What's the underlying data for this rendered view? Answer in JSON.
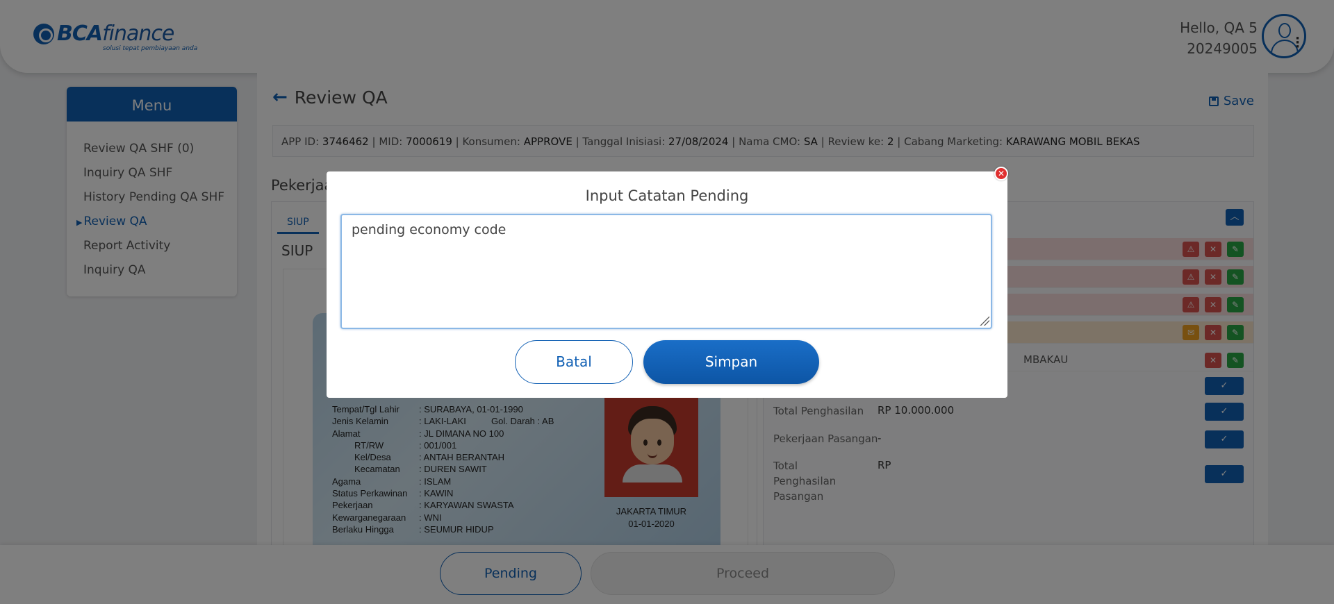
{
  "header": {
    "logo_text_bold": "BCA",
    "logo_text_rest": "finance",
    "logo_tagline": "solusi tepat pembiayaan anda",
    "greeting": "Hello, QA 5",
    "user_id": "20249005"
  },
  "sidebar": {
    "title": "Menu",
    "items": [
      {
        "label": "Review QA SHF (0)"
      },
      {
        "label": "Inquiry QA SHF"
      },
      {
        "label": "History Pending QA SHF"
      },
      {
        "label": "Review QA",
        "active": true
      },
      {
        "label": "Report Activity"
      },
      {
        "label": "Inquiry QA"
      }
    ]
  },
  "main": {
    "title": "Review QA",
    "save_label": "Save",
    "info": {
      "app_id_label": "APP ID: ",
      "app_id": "3746462",
      "mid_label": " | MID: ",
      "mid": "7000619",
      "konsumen_label": " | Konsumen: ",
      "konsumen": "APPROVE",
      "tanggal_label": " | Tanggal Inisiasi: ",
      "tanggal": "27/08/2024",
      "cmo_label": " | Nama CMO: ",
      "cmo": "SA",
      "review_label": " | Review ke: ",
      "review": "2",
      "cabang_label": " | Cabang Marketing: ",
      "cabang": "KARAWANG MOBIL BEKAS"
    },
    "section_title": "Pekerjaa",
    "tab": "SIUP",
    "doc_label": "SIUP",
    "ktp": {
      "rows": [
        {
          "key": "Tempat/Tgl Lahir",
          "val": ": SURABAYA, 01-01-1990",
          "indent": false
        },
        {
          "key": "Jenis Kelamin",
          "val": ": LAKI-LAKI          Gol. Darah : AB",
          "indent": false
        },
        {
          "key": "Alamat",
          "val": ": JL DIMANA NO 100",
          "indent": false
        },
        {
          "key": "RT/RW",
          "val": ": 001/001",
          "indent": true
        },
        {
          "key": "Kel/Desa",
          "val": ": ANTAH BERANTAH",
          "indent": true
        },
        {
          "key": "Kecamatan",
          "val": ": DUREN SAWIT",
          "indent": true
        },
        {
          "key": "Agama",
          "val": ": ISLAM",
          "indent": false
        },
        {
          "key": "Status Perkawinan",
          "val": ": KAWIN",
          "indent": false
        },
        {
          "key": "Pekerjaan",
          "val": ": KARYAWAN SWASTA",
          "indent": false
        },
        {
          "key": "Kewarganegaraan",
          "val": ": WNI",
          "indent": false
        },
        {
          "key": "Berlaku Hingga",
          "val": ": SEUMUR HIDUP",
          "indent": false
        }
      ],
      "place": "JAKARTA TIMUR",
      "date": "01-01-2020"
    },
    "right": {
      "partial_text": "MBAKAU",
      "fields": [
        {
          "label": "Total Penghasilan",
          "value": "RP 10.000.000"
        },
        {
          "label": "Pekerjaan Pasangan",
          "value": "-"
        },
        {
          "label": "Total Penghasilan Pasangan",
          "value": "RP"
        }
      ]
    }
  },
  "bottom": {
    "pending_label": "Pending",
    "proceed_label": "Proceed"
  },
  "modal": {
    "title": "Input Catatan Pending",
    "textarea_value": "pending economy code",
    "cancel_label": "Batal",
    "save_label": "Simpan"
  },
  "colors": {
    "primary": "#1160b4",
    "danger": "#d9534f",
    "success": "#28a745",
    "warning": "#f0a020"
  }
}
